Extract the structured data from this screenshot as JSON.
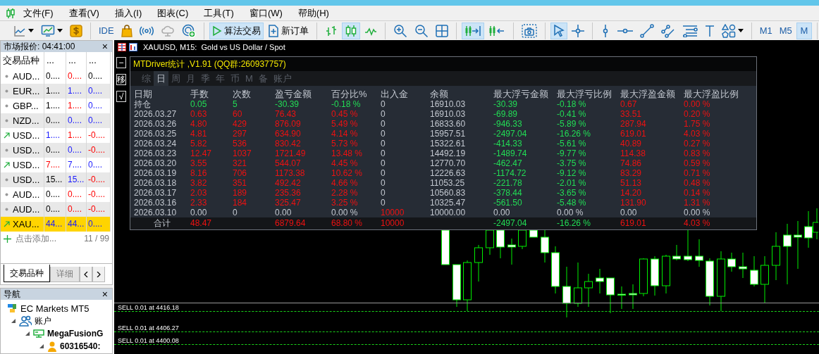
{
  "menu": [
    "文件(F)",
    "查看(V)",
    "插入(I)",
    "图表(C)",
    "工具(T)",
    "窗口(W)",
    "帮助(H)"
  ],
  "toolbar": [
    [
      {
        "selected": false
      },
      {
        "selected": false
      },
      {
        "selected": false
      }
    ],
    [
      {
        "label": "IDE",
        "selected": false
      },
      {
        "selected": false
      },
      {
        "selected": false
      },
      {
        "selected": false
      },
      {
        "selected": false
      }
    ],
    [
      {
        "label": "算法交易",
        "selected": true
      },
      {
        "label": "新订单",
        "selected": false
      }
    ],
    [
      {
        "selected": false
      },
      {
        "selected": true
      },
      {
        "selected": false
      }
    ],
    [
      {
        "selected": false
      },
      {
        "selected": false
      },
      {
        "selected": false
      }
    ],
    [
      {
        "selected": true
      },
      {
        "selected": false
      }
    ],
    [
      {
        "selected": false
      }
    ],
    [
      {
        "selected": true
      },
      {
        "selected": false
      }
    ],
    [
      {
        "selected": false
      },
      {
        "selected": false
      },
      {
        "selected": false
      },
      {
        "selected": false
      },
      {
        "selected": false
      },
      {
        "selected": false
      },
      {
        "selected": false
      }
    ],
    [
      {
        "label": "M1",
        "selected": false
      },
      {
        "label": "M5",
        "selected": false
      },
      {
        "label": "M",
        "selected": true
      }
    ]
  ],
  "market_watch": {
    "title": "市场报价: 04:41:00",
    "close": "×",
    "symbol_column": "交易品种",
    "columns": [
      "...",
      "...",
      "..."
    ],
    "rows": [
      {
        "kind": "dot",
        "symbol": "AUD...",
        "selected": false,
        "cells": [
          {
            "text": "0....",
            "color": "#000000"
          },
          {
            "text": "0....",
            "color": "#ff0000"
          },
          {
            "text": "0....",
            "color": "#000000"
          }
        ]
      },
      {
        "kind": "dot",
        "symbol": "EUR...",
        "selected": false,
        "cells": [
          {
            "text": "1....",
            "color": "#000000"
          },
          {
            "text": "1....",
            "color": "#1a1aff"
          },
          {
            "text": "0....",
            "color": "#1a1aff"
          }
        ]
      },
      {
        "kind": "dot",
        "symbol": "GBP...",
        "selected": false,
        "cells": [
          {
            "text": "1....",
            "color": "#000000"
          },
          {
            "text": "1....",
            "color": "#ff0000"
          },
          {
            "text": "0....",
            "color": "#1a1aff"
          }
        ]
      },
      {
        "kind": "dot",
        "symbol": "NZD...",
        "selected": false,
        "cells": [
          {
            "text": "0....",
            "color": "#000000"
          },
          {
            "text": "0....",
            "color": "#1a1aff"
          },
          {
            "text": "0....",
            "color": "#1a1aff"
          }
        ]
      },
      {
        "kind": "up",
        "symbol": "USD...",
        "selected": false,
        "cells": [
          {
            "text": "1....",
            "color": "#1a1aff"
          },
          {
            "text": "1....",
            "color": "#ff0000"
          },
          {
            "text": "-0....",
            "color": "#ff0000"
          }
        ]
      },
      {
        "kind": "dot",
        "symbol": "USD...",
        "selected": false,
        "cells": [
          {
            "text": "0....",
            "color": "#000000"
          },
          {
            "text": "0....",
            "color": "#1a1aff"
          },
          {
            "text": "-0....",
            "color": "#ff0000"
          }
        ]
      },
      {
        "kind": "up",
        "symbol": "USD...",
        "selected": false,
        "cells": [
          {
            "text": "7....",
            "color": "#ff0000"
          },
          {
            "text": "7....",
            "color": "#1a1aff"
          },
          {
            "text": "0....",
            "color": "#1a1aff"
          }
        ]
      },
      {
        "kind": "dot",
        "symbol": "USD...",
        "selected": false,
        "cells": [
          {
            "text": "15...",
            "color": "#000000"
          },
          {
            "text": "15...",
            "color": "#1a1aff"
          },
          {
            "text": "-0....",
            "color": "#ff0000"
          }
        ]
      },
      {
        "kind": "dot",
        "symbol": "AUD...",
        "selected": false,
        "cells": [
          {
            "text": "0....",
            "color": "#000000"
          },
          {
            "text": "0....",
            "color": "#ff0000"
          },
          {
            "text": "-0....",
            "color": "#ff0000"
          }
        ]
      },
      {
        "kind": "dot",
        "symbol": "AUD...",
        "selected": false,
        "cells": [
          {
            "text": "0....",
            "color": "#000000"
          },
          {
            "text": "0....",
            "color": "#ff0000"
          },
          {
            "text": "-0....",
            "color": "#ff0000"
          }
        ]
      },
      {
        "kind": "up",
        "symbol": "XAU...",
        "selected": true,
        "cells": [
          {
            "text": "44...",
            "color": "#1a1aff"
          },
          {
            "text": "44...",
            "color": "#1a1aff"
          },
          {
            "text": "0....",
            "color": "#1a1aff"
          }
        ]
      }
    ],
    "add_label": "点击添加...",
    "count": "11 / 99",
    "tabs": [
      {
        "label": "交易品种",
        "selected": true
      },
      {
        "label": "详细",
        "selected": false
      }
    ]
  },
  "navigator": {
    "title": "导航",
    "close": "×",
    "tree": [
      {
        "label": "EC Markets MT5",
        "children": [
          {
            "label": "账户",
            "expanded": true,
            "children": [
              {
                "label": "MegaFusionG",
                "expanded": true,
                "children": [
                  {
                    "label": "60316540:",
                    "expanded": true
                  }
                ]
              }
            ]
          }
        ]
      }
    ]
  },
  "chart": {
    "title": "XAUUSD, M15:  Gold vs US Dollar / Spot",
    "side_buttons": [
      "−",
      "移",
      "√"
    ],
    "orders": [
      "SELL 0.01 at 4416.18",
      "SELL 0.01 at 4406.27",
      "SELL 0.01 at 4400.08"
    ]
  },
  "stats": {
    "title": "MTDriver统计 ,V1.91 (QQ群:260937757)",
    "tabs": [
      {
        "label": "综",
        "selected": false
      },
      {
        "label": "日",
        "selected": true
      },
      {
        "label": "周",
        "selected": false
      },
      {
        "label": "月",
        "selected": false
      },
      {
        "label": "季",
        "selected": false
      },
      {
        "label": "年",
        "selected": false
      },
      {
        "label": "币",
        "selected": false
      },
      {
        "label": "M",
        "selected": false
      },
      {
        "label": "备",
        "selected": false
      },
      {
        "label": "账户",
        "selected": false
      }
    ],
    "date_column": "日期",
    "columns": [
      "手数",
      "次数",
      "盈亏金额",
      "百分比%",
      "出入金",
      "余额",
      "最大浮亏金额",
      "最大浮亏比例",
      "最大浮盈金额",
      "最大浮盈比例"
    ],
    "rows": [
      {
        "date": "持仓",
        "cells": [
          {
            "text": "0.05",
            "color": "#22dd55"
          },
          {
            "text": "5",
            "color": "#22dd55"
          },
          {
            "text": "-30.39",
            "color": "#22dd55"
          },
          {
            "text": "-0.18 %",
            "color": "#22dd55"
          },
          {
            "text": "0",
            "color": "#c3c8d0"
          },
          {
            "text": "16910.03",
            "color": "#c3c8d0"
          },
          {
            "text": "-30.39",
            "color": "#22dd55"
          },
          {
            "text": "-0.18 %",
            "color": "#22dd55"
          },
          {
            "text": "0.67",
            "color": "#ee1111"
          },
          {
            "text": "0.00 %",
            "color": "#ee1111"
          }
        ]
      },
      {
        "date": "2026.03.27",
        "cells": [
          {
            "text": "0.63",
            "color": "#ee1111"
          },
          {
            "text": "60",
            "color": "#ee1111"
          },
          {
            "text": "76.43",
            "color": "#ee1111"
          },
          {
            "text": "0.45 %",
            "color": "#ee1111"
          },
          {
            "text": "0",
            "color": "#c3c8d0"
          },
          {
            "text": "16910.03",
            "color": "#c3c8d0"
          },
          {
            "text": "-69.89",
            "color": "#22dd55"
          },
          {
            "text": "-0.41 %",
            "color": "#22dd55"
          },
          {
            "text": "33.51",
            "color": "#ee1111"
          },
          {
            "text": "0.20 %",
            "color": "#ee1111"
          }
        ]
      },
      {
        "date": "2026.03.26",
        "cells": [
          {
            "text": "4.80",
            "color": "#ee1111"
          },
          {
            "text": "429",
            "color": "#ee1111"
          },
          {
            "text": "876.09",
            "color": "#ee1111"
          },
          {
            "text": "5.49 %",
            "color": "#ee1111"
          },
          {
            "text": "0",
            "color": "#c3c8d0"
          },
          {
            "text": "16833.60",
            "color": "#c3c8d0"
          },
          {
            "text": "-946.33",
            "color": "#22dd55"
          },
          {
            "text": "-5.89 %",
            "color": "#22dd55"
          },
          {
            "text": "287.94",
            "color": "#ee1111"
          },
          {
            "text": "1.75 %",
            "color": "#ee1111"
          }
        ]
      },
      {
        "date": "2026.03.25",
        "cells": [
          {
            "text": "4.81",
            "color": "#ee1111"
          },
          {
            "text": "297",
            "color": "#ee1111"
          },
          {
            "text": "634.90",
            "color": "#ee1111"
          },
          {
            "text": "4.14 %",
            "color": "#ee1111"
          },
          {
            "text": "0",
            "color": "#c3c8d0"
          },
          {
            "text": "15957.51",
            "color": "#c3c8d0"
          },
          {
            "text": "-2497.04",
            "color": "#22dd55"
          },
          {
            "text": "-16.26 %",
            "color": "#22dd55"
          },
          {
            "text": "619.01",
            "color": "#ee1111"
          },
          {
            "text": "4.03 %",
            "color": "#ee1111"
          }
        ]
      },
      {
        "date": "2026.03.24",
        "cells": [
          {
            "text": "5.82",
            "color": "#ee1111"
          },
          {
            "text": "536",
            "color": "#ee1111"
          },
          {
            "text": "830.42",
            "color": "#ee1111"
          },
          {
            "text": "5.73 %",
            "color": "#ee1111"
          },
          {
            "text": "0",
            "color": "#c3c8d0"
          },
          {
            "text": "15322.61",
            "color": "#c3c8d0"
          },
          {
            "text": "-414.33",
            "color": "#22dd55"
          },
          {
            "text": "-5.61 %",
            "color": "#22dd55"
          },
          {
            "text": "40.89",
            "color": "#ee1111"
          },
          {
            "text": "0.27 %",
            "color": "#ee1111"
          }
        ]
      },
      {
        "date": "2026.03.23",
        "cells": [
          {
            "text": "12.47",
            "color": "#ee1111"
          },
          {
            "text": "1037",
            "color": "#ee1111"
          },
          {
            "text": "1721.49",
            "color": "#ee1111"
          },
          {
            "text": "13.48 %",
            "color": "#ee1111"
          },
          {
            "text": "0",
            "color": "#c3c8d0"
          },
          {
            "text": "14492.19",
            "color": "#c3c8d0"
          },
          {
            "text": "-1489.74",
            "color": "#22dd55"
          },
          {
            "text": "-9.77 %",
            "color": "#22dd55"
          },
          {
            "text": "114.38",
            "color": "#ee1111"
          },
          {
            "text": "0.83 %",
            "color": "#ee1111"
          }
        ]
      },
      {
        "date": "2026.03.20",
        "cells": [
          {
            "text": "3.55",
            "color": "#ee1111"
          },
          {
            "text": "321",
            "color": "#ee1111"
          },
          {
            "text": "544.07",
            "color": "#ee1111"
          },
          {
            "text": "4.45 %",
            "color": "#ee1111"
          },
          {
            "text": "0",
            "color": "#c3c8d0"
          },
          {
            "text": "12770.70",
            "color": "#c3c8d0"
          },
          {
            "text": "-462.47",
            "color": "#22dd55"
          },
          {
            "text": "-3.75 %",
            "color": "#22dd55"
          },
          {
            "text": "74.86",
            "color": "#ee1111"
          },
          {
            "text": "0.59 %",
            "color": "#ee1111"
          }
        ]
      },
      {
        "date": "2026.03.19",
        "cells": [
          {
            "text": "8.16",
            "color": "#ee1111"
          },
          {
            "text": "706",
            "color": "#ee1111"
          },
          {
            "text": "1173.38",
            "color": "#ee1111"
          },
          {
            "text": "10.62 %",
            "color": "#ee1111"
          },
          {
            "text": "0",
            "color": "#c3c8d0"
          },
          {
            "text": "12226.63",
            "color": "#c3c8d0"
          },
          {
            "text": "-1174.72",
            "color": "#22dd55"
          },
          {
            "text": "-9.12 %",
            "color": "#22dd55"
          },
          {
            "text": "83.29",
            "color": "#ee1111"
          },
          {
            "text": "0.71 %",
            "color": "#ee1111"
          }
        ]
      },
      {
        "date": "2026.03.18",
        "cells": [
          {
            "text": "3.82",
            "color": "#ee1111"
          },
          {
            "text": "351",
            "color": "#ee1111"
          },
          {
            "text": "492.42",
            "color": "#ee1111"
          },
          {
            "text": "4.66 %",
            "color": "#ee1111"
          },
          {
            "text": "0",
            "color": "#c3c8d0"
          },
          {
            "text": "11053.25",
            "color": "#c3c8d0"
          },
          {
            "text": "-221.78",
            "color": "#22dd55"
          },
          {
            "text": "-2.01 %",
            "color": "#22dd55"
          },
          {
            "text": "51.13",
            "color": "#ee1111"
          },
          {
            "text": "0.48 %",
            "color": "#ee1111"
          }
        ]
      },
      {
        "date": "2026.03.17",
        "cells": [
          {
            "text": "2.03",
            "color": "#ee1111"
          },
          {
            "text": "189",
            "color": "#ee1111"
          },
          {
            "text": "235.36",
            "color": "#ee1111"
          },
          {
            "text": "2.28 %",
            "color": "#ee1111"
          },
          {
            "text": "0",
            "color": "#c3c8d0"
          },
          {
            "text": "10560.83",
            "color": "#c3c8d0"
          },
          {
            "text": "-378.44",
            "color": "#22dd55"
          },
          {
            "text": "-3.65 %",
            "color": "#22dd55"
          },
          {
            "text": "14.20",
            "color": "#ee1111"
          },
          {
            "text": "0.14 %",
            "color": "#ee1111"
          }
        ]
      },
      {
        "date": "2026.03.16",
        "cells": [
          {
            "text": "2.33",
            "color": "#ee1111"
          },
          {
            "text": "184",
            "color": "#ee1111"
          },
          {
            "text": "325.47",
            "color": "#ee1111"
          },
          {
            "text": "3.25 %",
            "color": "#ee1111"
          },
          {
            "text": "0",
            "color": "#c3c8d0"
          },
          {
            "text": "10325.47",
            "color": "#c3c8d0"
          },
          {
            "text": "-561.50",
            "color": "#22dd55"
          },
          {
            "text": "-5.48 %",
            "color": "#22dd55"
          },
          {
            "text": "131.90",
            "color": "#ee1111"
          },
          {
            "text": "1.31 %",
            "color": "#ee1111"
          }
        ]
      },
      {
        "date": "2026.03.10",
        "cells": [
          {
            "text": "0.00",
            "color": "#c3c8d0"
          },
          {
            "text": "0",
            "color": "#c3c8d0"
          },
          {
            "text": "0.00",
            "color": "#c3c8d0"
          },
          {
            "text": "0.00 %",
            "color": "#c3c8d0"
          },
          {
            "text": "10000",
            "color": "#ee1111"
          },
          {
            "text": "10000.00",
            "color": "#c3c8d0"
          },
          {
            "text": "0.00",
            "color": "#c3c8d0"
          },
          {
            "text": "0.00 %",
            "color": "#c3c8d0"
          },
          {
            "text": "0.00",
            "color": "#c3c8d0"
          },
          {
            "text": "0.00 %",
            "color": "#c3c8d0"
          }
        ]
      }
    ],
    "total": {
      "label": "合计",
      "cells": [
        {
          "text": "48.47",
          "color": "#ee1111"
        },
        null,
        {
          "text": "6879.64",
          "color": "#ee1111"
        },
        {
          "text": "68.80 %",
          "color": "#ee1111"
        },
        {
          "text": "10000",
          "color": "#ee1111"
        },
        null,
        {
          "text": "-2497.04",
          "color": "#22dd55"
        },
        {
          "text": "-16.26 %",
          "color": "#22dd55"
        },
        {
          "text": "619.01",
          "color": "#ee1111"
        },
        {
          "text": "4.03 %",
          "color": "#ee1111"
        }
      ]
    }
  }
}
